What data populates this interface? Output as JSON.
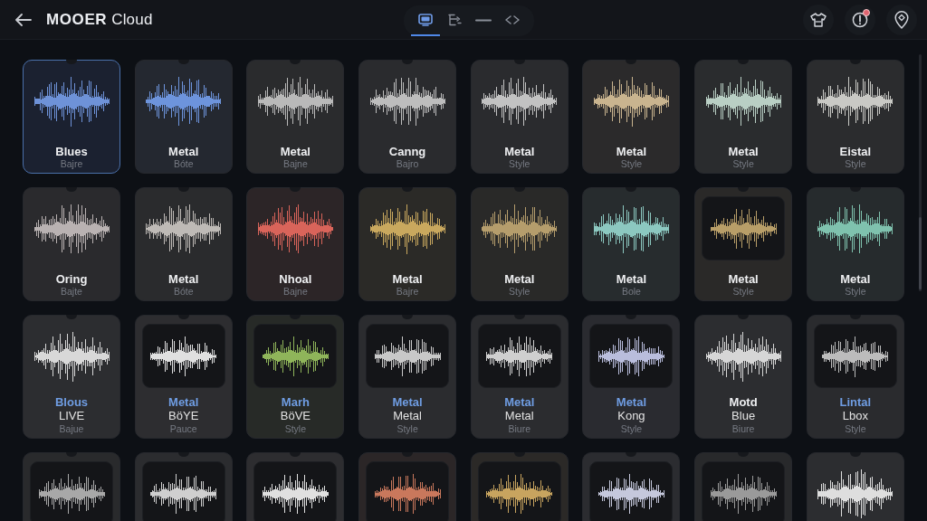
{
  "header": {
    "title": "**MOOER** Cloud",
    "tabs": [
      {
        "selected": true
      },
      {
        "selected": false
      },
      {
        "selected": false
      },
      {
        "selected": false
      }
    ],
    "alert_badge": true
  },
  "presets": [
    {
      "name": "Blues",
      "style": "Bajre",
      "color": "#6e92d8",
      "kind": "plain",
      "selected": true,
      "accent": false
    },
    {
      "name": "Metal",
      "style": "Bóte",
      "color": "#6d94dc",
      "kind": "plain",
      "selected": false,
      "accent": false
    },
    {
      "name": "Metal",
      "style": "Bajne",
      "color": "#b9b9b9",
      "kind": "plain",
      "selected": false,
      "accent": false
    },
    {
      "name": "Canng",
      "style": "Bajro",
      "color": "#bdbdbd",
      "kind": "plain",
      "selected": false,
      "accent": false
    },
    {
      "name": "Metal",
      "style": "Style",
      "color": "#c2c2c2",
      "kind": "plain",
      "selected": false,
      "accent": false
    },
    {
      "name": "Metal",
      "style": "Style",
      "color": "#c9b48f",
      "kind": "plain",
      "selected": false,
      "accent": false
    },
    {
      "name": "Metal",
      "style": "Style",
      "color": "#b9cfc4",
      "kind": "plain",
      "selected": false,
      "accent": false
    },
    {
      "name": "Eistal",
      "style": "Style",
      "color": "#c9c9c5",
      "kind": "plain",
      "selected": false,
      "accent": false
    },
    {
      "name": "Oring",
      "style": "Bajte",
      "color": "#b9b2b2",
      "kind": "plain",
      "selected": false,
      "accent": false
    },
    {
      "name": "Metal",
      "style": "Bóte",
      "color": "#bebab6",
      "kind": "plain",
      "selected": false,
      "accent": false
    },
    {
      "name": "Nhoal",
      "style": "Bajne",
      "color": "#d9645a",
      "kind": "plain",
      "selected": false,
      "accent": false
    },
    {
      "name": "Metal",
      "style": "Bajre",
      "color": "#c9a85e",
      "kind": "plain",
      "selected": false,
      "accent": false
    },
    {
      "name": "Metal",
      "style": "Style",
      "color": "#b59d6c",
      "kind": "plain",
      "selected": false,
      "accent": false
    },
    {
      "name": "Metal",
      "style": "Bole",
      "color": "#8cc8c0",
      "kind": "plain",
      "selected": false,
      "accent": false
    },
    {
      "name": "Metal",
      "style": "Style",
      "color": "#b89e68",
      "kind": "framed",
      "selected": false,
      "accent": false
    },
    {
      "name": "Metal",
      "style": "Style",
      "color": "#7fc2ae",
      "kind": "plain",
      "selected": false,
      "accent": false
    },
    {
      "name": "Blous",
      "variant": "LIVE",
      "style": "Bajue",
      "color": "#d8d8d8",
      "kind": "plain",
      "selected": false,
      "accent": true
    },
    {
      "name": "Metal",
      "variant": "BöYE",
      "style": "Pauce",
      "color": "#e0e0e0",
      "kind": "framed",
      "selected": false,
      "accent": true
    },
    {
      "name": "Marh",
      "variant": "BöVE",
      "style": "Style",
      "color": "#8fb55a",
      "kind": "framed",
      "selected": false,
      "accent": true
    },
    {
      "name": "Metal",
      "variant": "Metal",
      "style": "Style",
      "color": "#c8c8c8",
      "kind": "framed",
      "selected": false,
      "accent": true
    },
    {
      "name": "Metal",
      "variant": "Metal",
      "style": "Biure",
      "color": "#cfcfcf",
      "kind": "framed",
      "selected": false,
      "accent": true
    },
    {
      "name": "Metal",
      "variant": "Kong",
      "style": "Style",
      "color": "#b9bddc",
      "kind": "framed",
      "selected": false,
      "accent": true
    },
    {
      "name": "Motd",
      "variant": "Blue",
      "style": "Biure",
      "color": "#d6d6d6",
      "kind": "plain",
      "selected": false,
      "accent": false
    },
    {
      "name": "Lintal",
      "variant": "Lbox",
      "style": "Style",
      "color": "#bcbcbc",
      "kind": "framed",
      "selected": false,
      "accent": true
    },
    {
      "color": "#a8a8a8",
      "kind": "framed",
      "selected": false
    },
    {
      "color": "#cfcfcf",
      "kind": "framed",
      "selected": false
    },
    {
      "color": "#e0e0e0",
      "kind": "framed",
      "selected": false
    },
    {
      "color": "#c9785c",
      "kind": "framed",
      "selected": false
    },
    {
      "color": "#c8a45f",
      "kind": "framed",
      "selected": false
    },
    {
      "color": "#c5c8dc",
      "kind": "framed",
      "selected": false
    },
    {
      "color": "#9a9a9a",
      "kind": "framed",
      "selected": false
    },
    {
      "color": "#dedede",
      "kind": "plain",
      "selected": false
    }
  ]
}
